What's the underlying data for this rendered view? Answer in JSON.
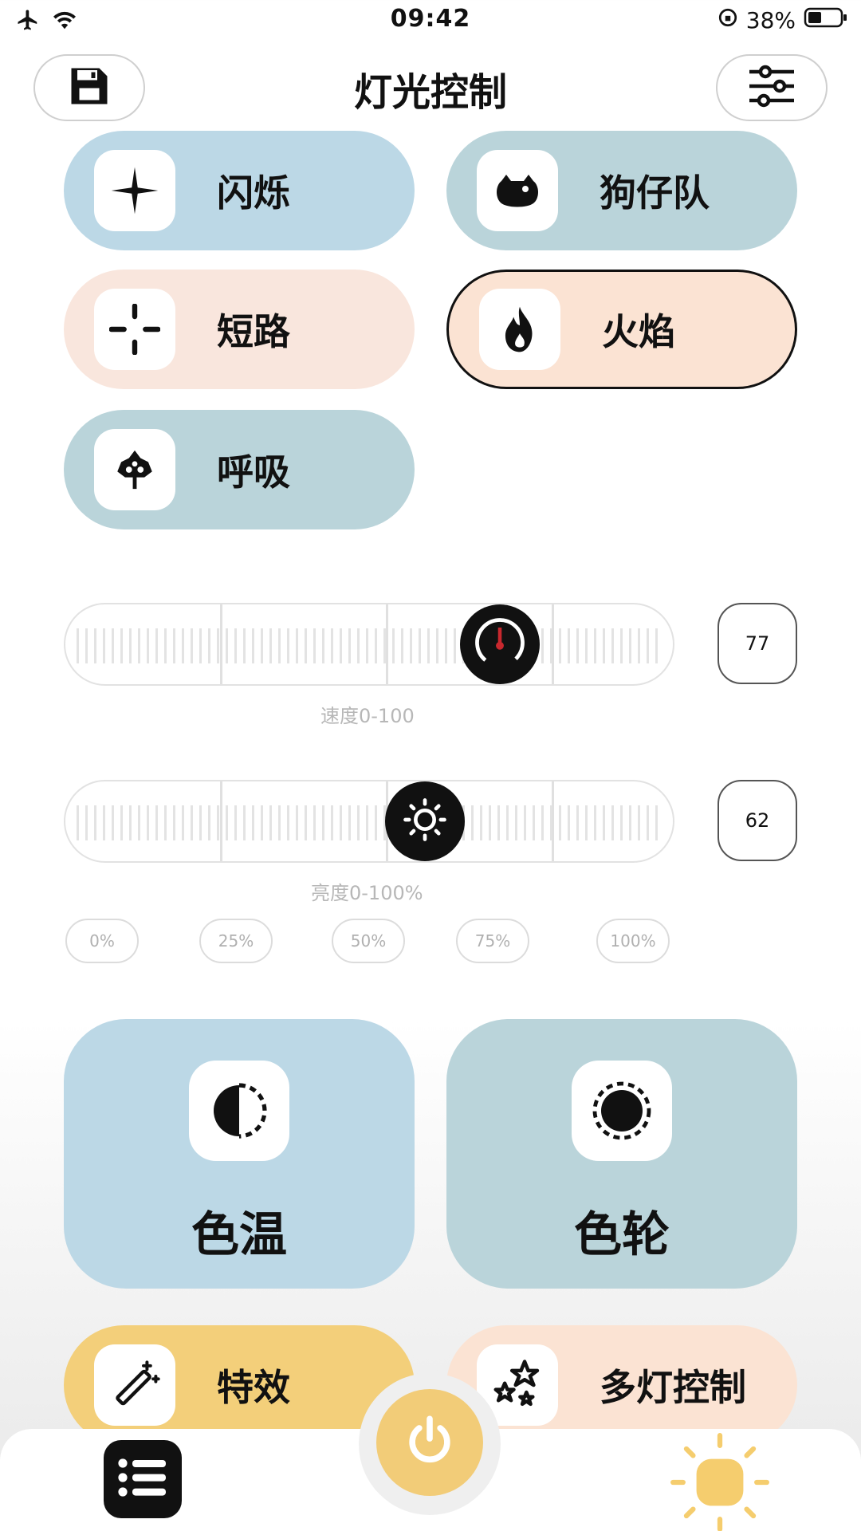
{
  "status_bar": {
    "time": "09:42",
    "battery": "38%"
  },
  "header": {
    "title": "灯光控制"
  },
  "modes": [
    {
      "label": "闪烁",
      "icon": "sparkle-icon"
    },
    {
      "label": "狗仔队",
      "icon": "paparazzi-icon"
    },
    {
      "label": "短路",
      "icon": "crosshair-icon"
    },
    {
      "label": "火焰",
      "icon": "flame-icon",
      "selected": true
    },
    {
      "label": "呼吸",
      "icon": "breath-icon"
    }
  ],
  "speed": {
    "value": "77",
    "level_fraction": 0.77,
    "caption": "速度0-100"
  },
  "brightness": {
    "value": "62",
    "level_fraction": 0.62,
    "caption": "亮度0-100%"
  },
  "presets": [
    "0%",
    "25%",
    "50%",
    "75%",
    "100%"
  ],
  "cards": [
    {
      "label": "色温",
      "icon": "color-temperature-icon"
    },
    {
      "label": "色轮",
      "icon": "color-wheel-icon"
    }
  ],
  "actions": [
    {
      "label": "特效",
      "icon": "magic-wand-icon"
    },
    {
      "label": "多灯控制",
      "icon": "stars-icon"
    }
  ],
  "colors": {
    "blue": "#bcd8e6",
    "teal": "#bad4da",
    "peach": "#f9e6dd",
    "yellow": "#f3cf7a"
  }
}
